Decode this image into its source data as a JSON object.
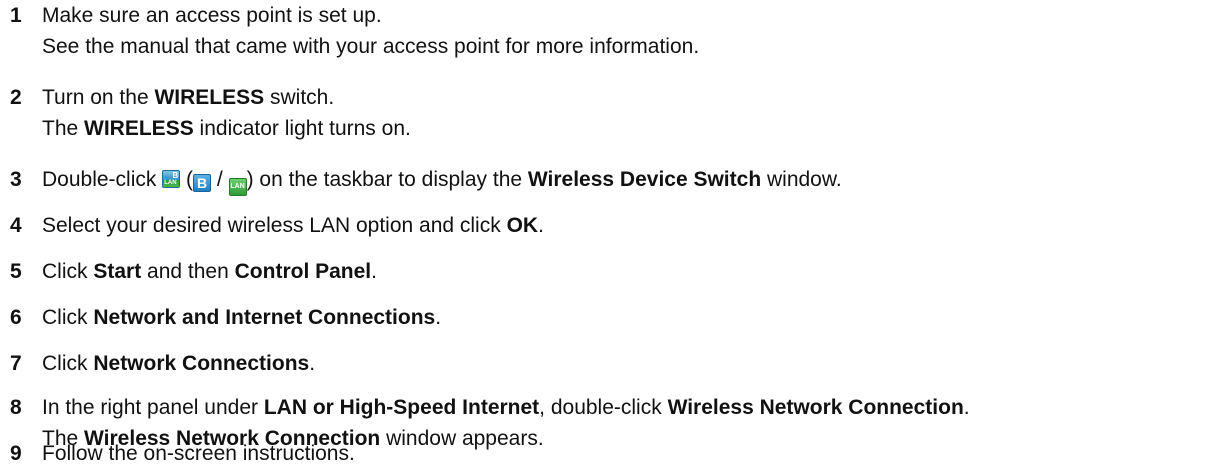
{
  "steps": [
    {
      "number": "1",
      "lines": [
        [
          {
            "t": "Make sure an access point is set up."
          }
        ],
        [
          {
            "t": "See the manual that came with your access point for more information."
          }
        ]
      ]
    },
    {
      "number": "2",
      "lines": [
        [
          {
            "t": "Turn on the "
          },
          {
            "t": "WIRELESS",
            "b": true
          },
          {
            "t": " switch."
          }
        ],
        [
          {
            "t": "The "
          },
          {
            "t": "WIRELESS",
            "b": true
          },
          {
            "t": " indicator light turns on."
          }
        ]
      ]
    },
    {
      "number": "3",
      "lines": [
        [
          {
            "t": "Double-click "
          },
          {
            "icon": "wireless-switch-icon"
          },
          {
            "t": " ("
          },
          {
            "icon": "bluetooth-icon"
          },
          {
            "t": " / "
          },
          {
            "icon": "lan-icon"
          },
          {
            "t": ") on the taskbar to display the "
          },
          {
            "t": "Wireless Device Switch",
            "b": true
          },
          {
            "t": " window."
          }
        ]
      ]
    },
    {
      "number": "4",
      "lines": [
        [
          {
            "t": "Select your desired wireless LAN option and click "
          },
          {
            "t": "OK",
            "b": true
          },
          {
            "t": "."
          }
        ]
      ]
    },
    {
      "number": "5",
      "lines": [
        [
          {
            "t": "Click "
          },
          {
            "t": "Start",
            "b": true
          },
          {
            "t": " and then "
          },
          {
            "t": "Control Panel",
            "b": true
          },
          {
            "t": "."
          }
        ]
      ]
    },
    {
      "number": "6",
      "lines": [
        [
          {
            "t": "Click "
          },
          {
            "t": "Network and Internet Connections",
            "b": true
          },
          {
            "t": "."
          }
        ]
      ]
    },
    {
      "number": "7",
      "lines": [
        [
          {
            "t": "Click "
          },
          {
            "t": "Network Connections",
            "b": true
          },
          {
            "t": "."
          }
        ]
      ]
    },
    {
      "number": "8",
      "lines": [
        [
          {
            "t": "In the right panel under "
          },
          {
            "t": "LAN or High-Speed Internet",
            "b": true
          },
          {
            "t": ", double-click "
          },
          {
            "t": "Wireless Network Connection",
            "b": true
          },
          {
            "t": "."
          }
        ],
        [
          {
            "t": "The "
          },
          {
            "t": "Wireless Network Connection",
            "b": true
          },
          {
            "t": " window appears."
          }
        ]
      ]
    },
    {
      "number": "9",
      "lines": [
        [
          {
            "t": "Follow the on-screen instructions."
          }
        ]
      ]
    }
  ],
  "icons": {
    "wireless-switch-icon": {
      "label_top": "B",
      "label_bottom": "LAN"
    },
    "bluetooth-icon": {
      "label": "B"
    },
    "lan-icon": {
      "label": "LAN"
    }
  }
}
